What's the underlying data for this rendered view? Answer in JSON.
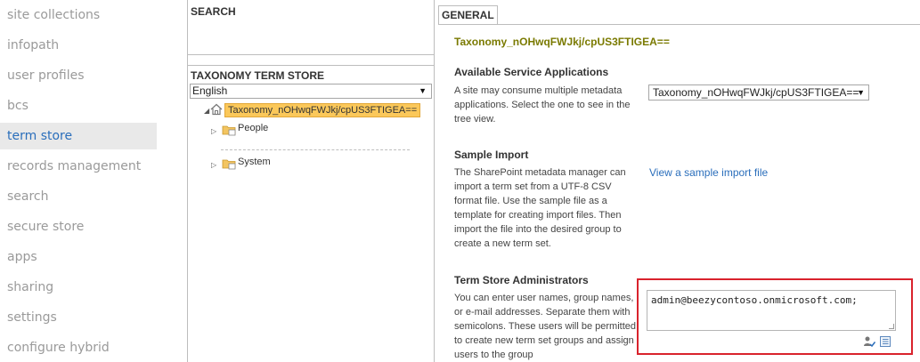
{
  "nav": {
    "items": [
      {
        "label": "site collections"
      },
      {
        "label": "infopath"
      },
      {
        "label": "user profiles"
      },
      {
        "label": "bcs"
      },
      {
        "label": "term store",
        "active": true
      },
      {
        "label": "records management"
      },
      {
        "label": "search"
      },
      {
        "label": "secure store"
      },
      {
        "label": "apps"
      },
      {
        "label": "sharing"
      },
      {
        "label": "settings"
      },
      {
        "label": "configure hybrid"
      }
    ]
  },
  "search_panel": {
    "title": "SEARCH"
  },
  "taxonomy_panel": {
    "title": "TAXONOMY TERM STORE",
    "language": "English",
    "root": {
      "label": "Taxonomy_nOHwqFWJkj/cpUS3FTIGEA=="
    },
    "groups": [
      {
        "label": "People"
      },
      {
        "label": "System"
      }
    ]
  },
  "general": {
    "tab_label": "GENERAL",
    "term_store_name": "Taxonomy_nOHwqFWJkj/cpUS3FTIGEA==",
    "available_services": {
      "heading": "Available Service Applications",
      "description": "A site may consume multiple metadata applications. Select the one to see in the tree view.",
      "selected": "Taxonomy_nOHwqFWJkj/cpUS3FTIGEA=="
    },
    "sample_import": {
      "heading": "Sample Import",
      "description": "The SharePoint metadata manager can import a term set from a UTF-8 CSV format file. Use the sample file as a template for creating import files. Then import the file into the desired group to create a new term set.",
      "link": "View a sample import file"
    },
    "administrators": {
      "heading": "Term Store Administrators",
      "description": "You can enter user names, group names, or e-mail addresses. Separate them with semicolons. These users will be permitted to create new term set groups and assign users to the group",
      "value": "admin@beezycontoso.onmicrosoft.com;"
    }
  },
  "colors": {
    "accent": "#2a6ebb",
    "highlight_border": "#d9232d",
    "selected_node": "#fbc85a",
    "term_title": "#7a7a00"
  },
  "icons": {
    "root": "taxonomy-home-icon",
    "group": "folder-group-icon",
    "check_names": "check-names-icon",
    "browse": "address-book-icon"
  }
}
